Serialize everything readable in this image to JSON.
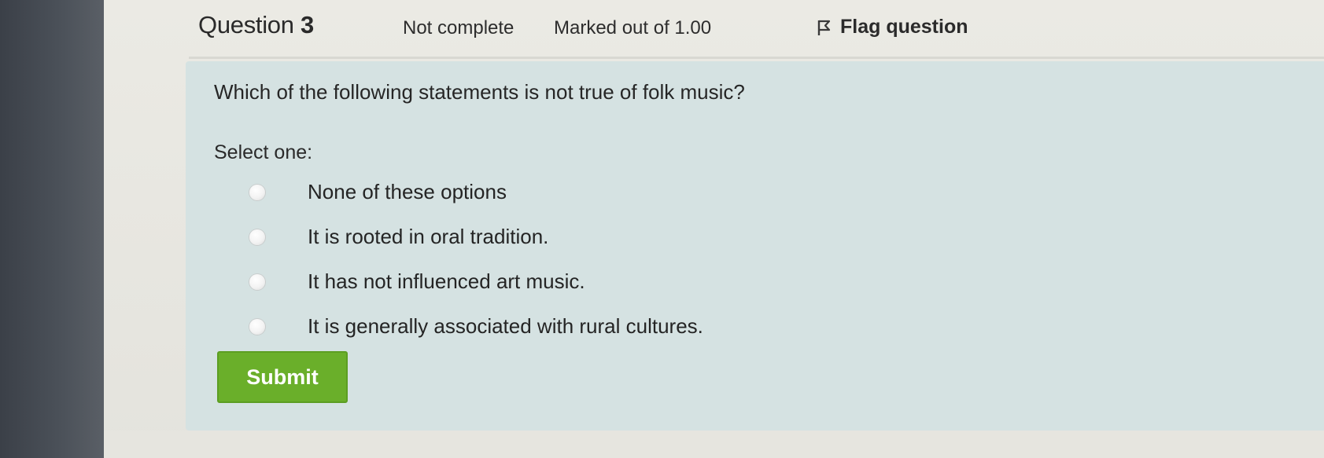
{
  "header": {
    "question_label": "Question",
    "question_number": "3",
    "state": "Not complete",
    "grade": "Marked out of 1.00",
    "flag_label": "Flag question",
    "flag_icon": "flag-icon"
  },
  "question": {
    "text": "Which of the following statements is not true of folk music?",
    "prompt": "Select one:",
    "options": [
      {
        "label": "None of these options",
        "selected": false
      },
      {
        "label": "It is rooted in oral tradition.",
        "selected": false
      },
      {
        "label": "It has not influenced art music.",
        "selected": false
      },
      {
        "label": "It is generally associated with rural cultures.",
        "selected": false
      }
    ]
  },
  "actions": {
    "submit_label": "Submit"
  },
  "colors": {
    "formulation_bg": "#d5e2e2",
    "submit_bg": "#6aaf2a",
    "page_bg": "#e4e3dd"
  }
}
